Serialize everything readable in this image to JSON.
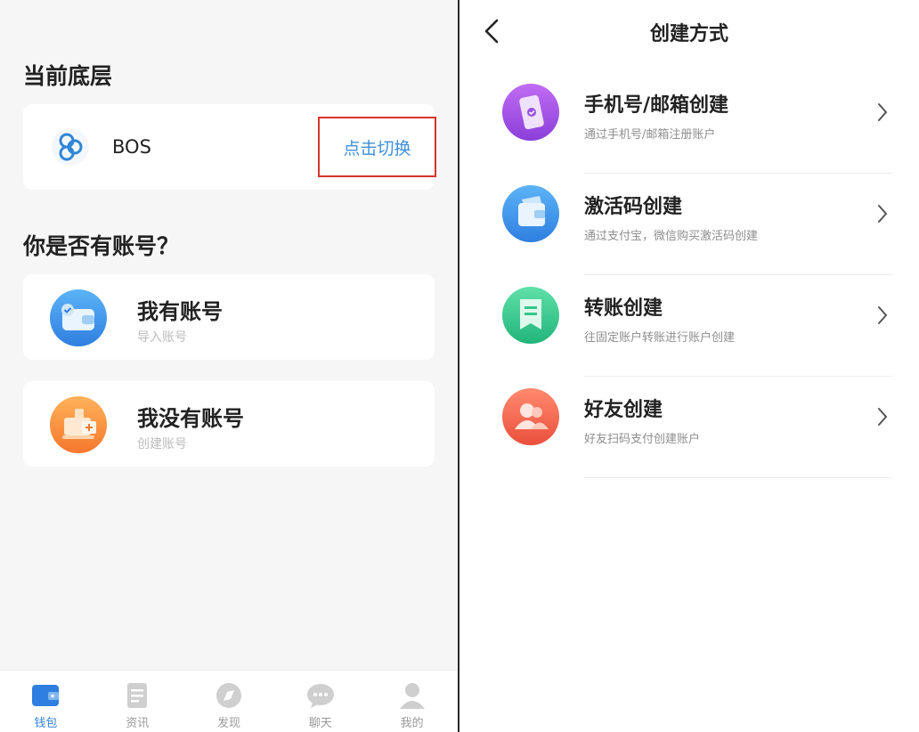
{
  "left": {
    "current_chain_title": "当前底层",
    "chain": {
      "name": "BOS",
      "switch_label": "点击切换"
    },
    "account_question": "你是否有账号？",
    "options": [
      {
        "title": "我有账号",
        "subtitle": "导入账号"
      },
      {
        "title": "我没有账号",
        "subtitle": "创建账号"
      }
    ],
    "tabs": [
      {
        "label": "钱包",
        "icon": "wallet-icon",
        "active": true
      },
      {
        "label": "资讯",
        "icon": "news-icon",
        "active": false
      },
      {
        "label": "发现",
        "icon": "discover-icon",
        "active": false
      },
      {
        "label": "聊天",
        "icon": "chat-icon",
        "active": false
      },
      {
        "label": "我的",
        "icon": "profile-icon",
        "active": false
      }
    ]
  },
  "right": {
    "title": "创建方式",
    "methods": [
      {
        "title": "手机号/邮箱创建",
        "subtitle": "通过手机号/邮箱注册账户",
        "icon": "phone-icon",
        "color": "#9b4fe0"
      },
      {
        "title": "激活码创建",
        "subtitle": "通过支付宝，微信购买激活码创建",
        "icon": "wallet-icon",
        "color": "#3a8ef0"
      },
      {
        "title": "转账创建",
        "subtitle": "往固定账户转账进行账户创建",
        "icon": "transfer-icon",
        "color": "#33c78c"
      },
      {
        "title": "好友创建",
        "subtitle": "好友扫码支付创建账户",
        "icon": "friends-icon",
        "color": "#f2644f"
      }
    ]
  },
  "colors": {
    "accent_blue": "#2f7fe0",
    "link_blue": "#3e8fd8",
    "highlight_red": "#d9342b"
  }
}
